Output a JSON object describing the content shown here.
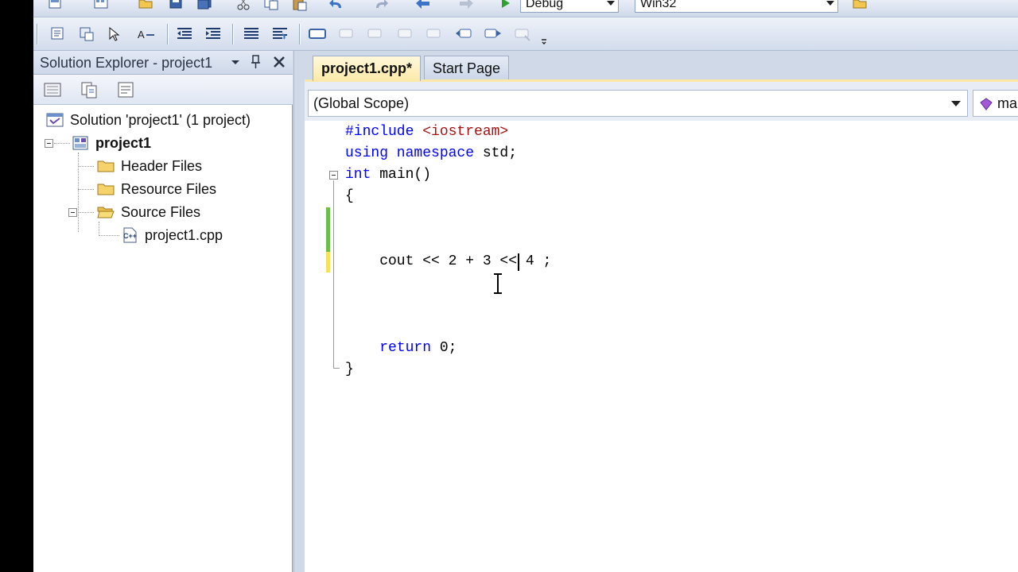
{
  "toolbar": {
    "config_value": "Debug",
    "platform_value": "Win32"
  },
  "solution_explorer": {
    "title": "Solution Explorer - project1",
    "tree": [
      {
        "label": "Solution 'project1' (1 project)"
      },
      {
        "label": "project1"
      },
      {
        "label": "Header Files"
      },
      {
        "label": "Resource Files"
      },
      {
        "label": "Source Files"
      },
      {
        "label": "project1.cpp"
      }
    ]
  },
  "tabs": [
    {
      "label": "project1.cpp*",
      "active": true
    },
    {
      "label": "Start Page",
      "active": false
    }
  ],
  "navigation": {
    "scope": "(Global Scope)",
    "member": "ma"
  },
  "code": {
    "lines": [
      {
        "parts": [
          {
            "t": "#include ",
            "c": "kw"
          },
          {
            "t": "<iostream>",
            "c": "str"
          }
        ]
      },
      {
        "parts": [
          {
            "t": "using namespace ",
            "c": "kw"
          },
          {
            "t": "std;",
            "c": ""
          }
        ]
      },
      {
        "parts": [
          {
            "t": "int ",
            "c": "kw"
          },
          {
            "t": "main()",
            "c": ""
          }
        ]
      },
      {
        "parts": [
          {
            "t": "{",
            "c": ""
          }
        ]
      },
      {
        "parts": [
          {
            "t": "    cout << 2 + 3 << 4 ;",
            "c": ""
          }
        ]
      },
      {
        "parts": [
          {
            "t": "    ",
            "c": ""
          },
          {
            "t": "return ",
            "c": "kw"
          },
          {
            "t": "0;",
            "c": ""
          }
        ]
      },
      {
        "parts": [
          {
            "t": "}",
            "c": ""
          }
        ]
      }
    ]
  },
  "colors": {
    "keyword": "#0000ff",
    "string": "#a31515",
    "saved_change": "#6cc04a",
    "unsaved_change": "#f2e35a",
    "active_tab": "#fde9a8"
  }
}
